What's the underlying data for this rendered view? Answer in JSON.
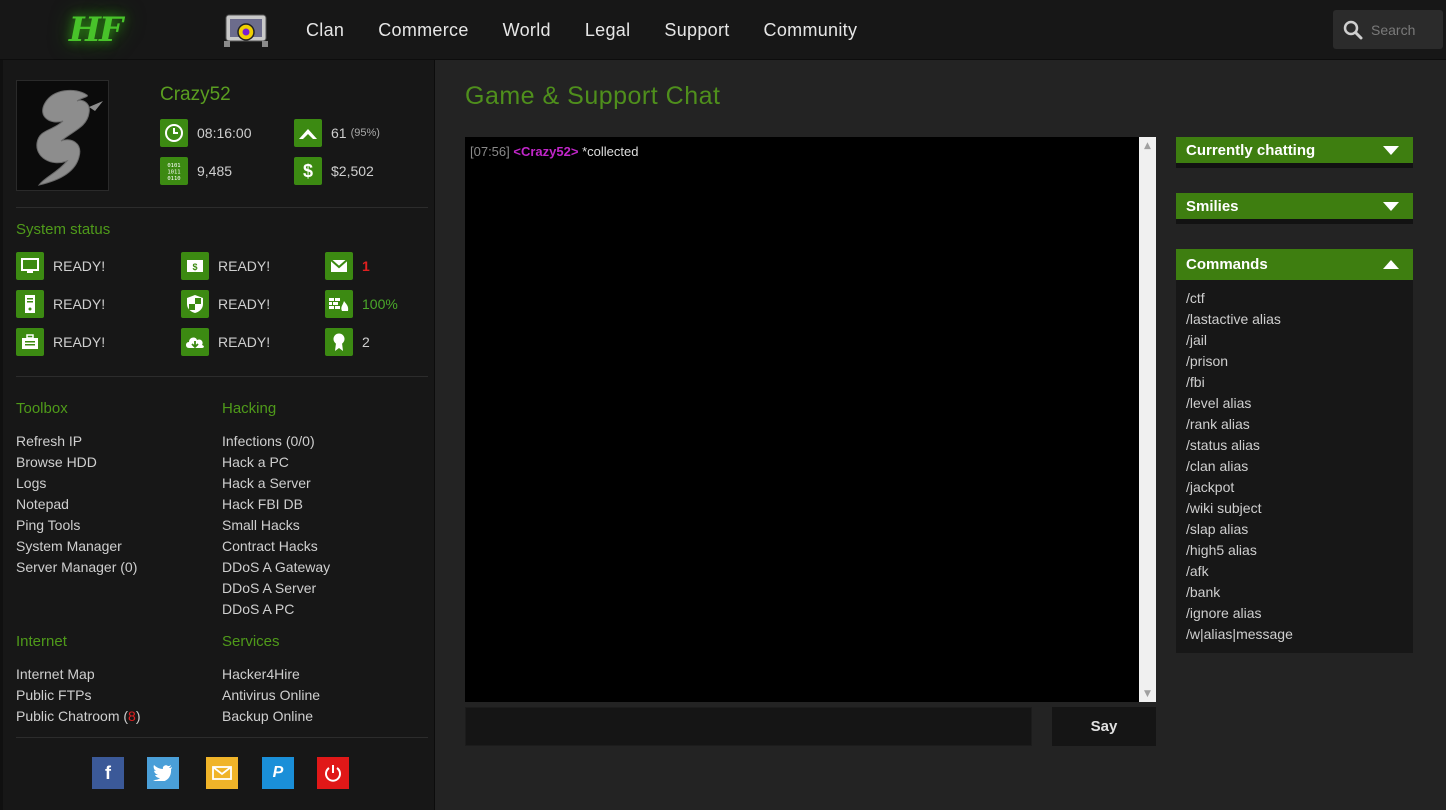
{
  "header": {
    "logo_text": "HF",
    "nav": [
      "Clan",
      "Commerce",
      "World",
      "Legal",
      "Support",
      "Community"
    ],
    "search_placeholder": "Search"
  },
  "profile": {
    "username": "Crazy52",
    "time": "08:16:00",
    "level": "61",
    "level_pct": "(95%)",
    "bits": "9,485",
    "money": "$2,502"
  },
  "system_status": {
    "title": "System status",
    "items": [
      {
        "icon": "monitor-icon",
        "value": "READY!"
      },
      {
        "icon": "money-transfer-icon",
        "value": "READY!"
      },
      {
        "icon": "mail-icon",
        "value": "1"
      },
      {
        "icon": "server-icon",
        "value": "READY!"
      },
      {
        "icon": "shield-icon",
        "value": "READY!"
      },
      {
        "icon": "firewall-icon",
        "value": "100%"
      },
      {
        "icon": "briefcase-icon",
        "value": "READY!"
      },
      {
        "icon": "cloud-download-icon",
        "value": "READY!"
      },
      {
        "icon": "award-icon",
        "value": "2"
      }
    ]
  },
  "toolbox": {
    "title": "Toolbox",
    "items": [
      "Refresh IP",
      "Browse HDD",
      "Logs",
      "Notepad",
      "Ping Tools",
      "System Manager",
      "Server Manager (0)"
    ]
  },
  "hacking": {
    "title": "Hacking",
    "items": [
      "Infections (0/0)",
      "Hack a PC",
      "Hack a Server",
      "Hack FBI DB",
      "Small Hacks",
      "Contract Hacks",
      "DDoS A Gateway",
      "DDoS A Server",
      "DDoS A PC"
    ]
  },
  "internet": {
    "title": "Internet",
    "items": [
      "Internet Map",
      "Public FTPs"
    ],
    "chatroom_label": "Public Chatroom (",
    "chatroom_count": "8",
    "chatroom_close": ")"
  },
  "services": {
    "title": "Services",
    "items": [
      "Hacker4Hire",
      "Antivirus Online",
      "Backup Online"
    ]
  },
  "social": {
    "colors": {
      "facebook": "#3b5998",
      "twitter": "#4a9fd8",
      "mail": "#f0b429",
      "paypal": "#1a8fd8",
      "logout": "#e01818"
    }
  },
  "main": {
    "title": "Game & Support Chat",
    "chat": {
      "time": "[07:56]",
      "nick": "<Crazy52>",
      "message": " *collected"
    },
    "say_label": "Say"
  },
  "panels": {
    "chatting": "Currently chatting",
    "smilies": "Smilies",
    "commands": "Commands",
    "command_list": [
      "/ctf",
      "/lastactive alias",
      "/jail",
      "/prison",
      "/fbi",
      "/level alias",
      "/rank alias",
      "/status alias",
      "/clan alias",
      "/jackpot",
      "/wiki subject",
      "/slap alias",
      "/high5 alias",
      "/afk",
      "/bank",
      "/ignore alias",
      "/w|alias|message"
    ]
  }
}
